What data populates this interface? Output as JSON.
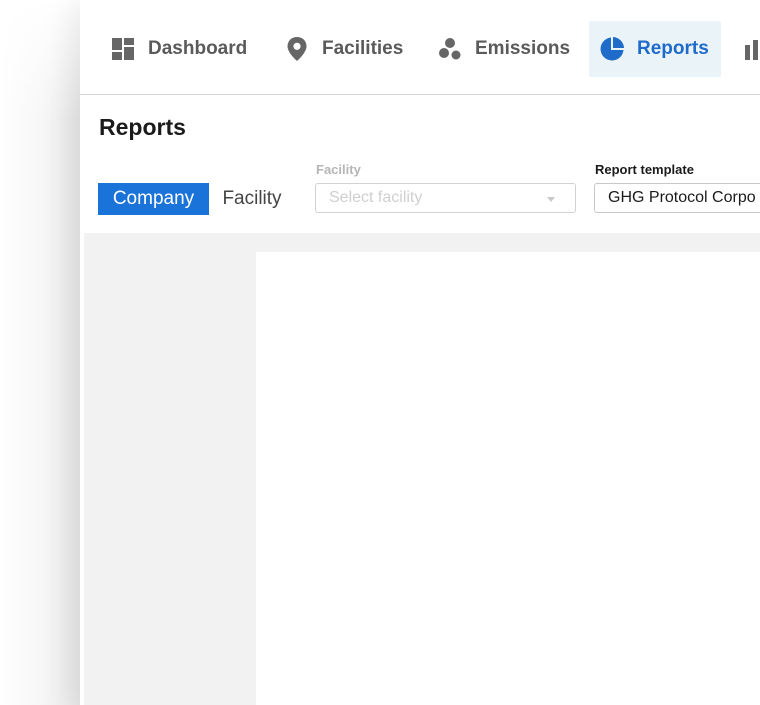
{
  "nav": {
    "items": [
      {
        "label": "Dashboard",
        "icon": "dashboard-icon"
      },
      {
        "label": "Facilities",
        "icon": "map-pin-icon"
      },
      {
        "label": "Emissions",
        "icon": "molecules-icon"
      },
      {
        "label": "Reports",
        "icon": "pie-chart-icon",
        "active": true
      }
    ],
    "more_icon": "bar-chart-icon"
  },
  "page": {
    "title": "Reports"
  },
  "scope_toggle": {
    "options": [
      "Company",
      "Facility"
    ],
    "selected": "Company"
  },
  "filters": {
    "facility": {
      "label": "Facility",
      "placeholder": "Select facility"
    },
    "template": {
      "label": "Report template",
      "value": "GHG Protocol Corpo"
    }
  },
  "colors": {
    "accent": "#1a73d8",
    "active_nav_bg": "#eaf3f8",
    "active_nav_text": "#1e6bc9",
    "nav_text": "#5a5a5a",
    "content_bg": "#f2f2f2"
  }
}
